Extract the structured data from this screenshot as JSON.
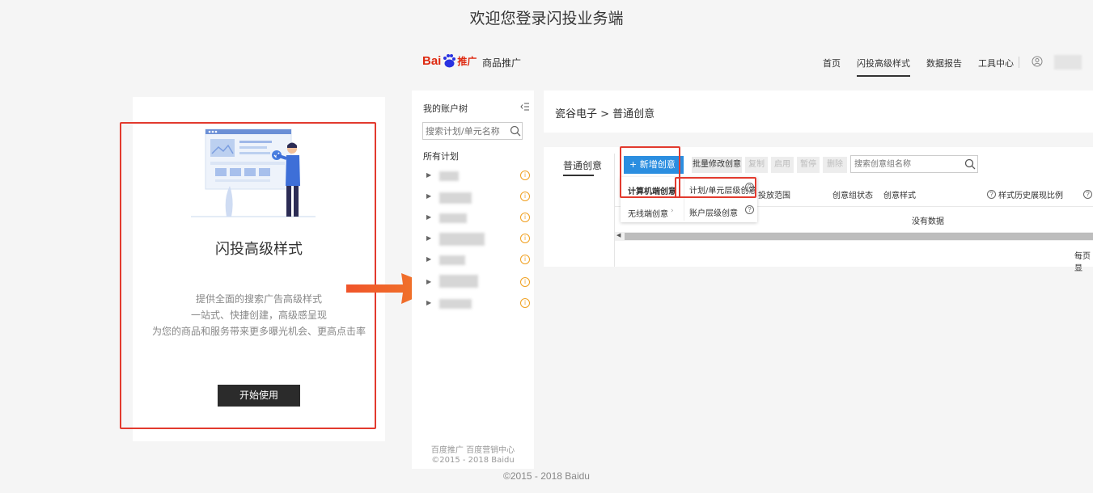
{
  "page": {
    "title": "欢迎您登录闪投业务端",
    "copyright": "©2015 - 2018 Baidu"
  },
  "intro": {
    "title": "闪投高级样式",
    "desc_lines": [
      "提供全面的搜索广告高级样式",
      "一站式、快捷创建，高级感呈现",
      "为您的商品和服务带来更多曝光机会、更高点击率"
    ],
    "start_button": "开始使用"
  },
  "header": {
    "logo_text": "Bai",
    "logo_suffix": "推广",
    "product": "商品推广",
    "nav": [
      "首页",
      "闪投高级样式",
      "数据报告",
      "工具中心"
    ],
    "active_nav": "闪投高级样式"
  },
  "tree": {
    "title": "我的账户树",
    "search_placeholder": "搜索计划/单元名称",
    "all_plans": "所有计划",
    "footer_links": "百度推广  百度营销中心",
    "footer_copyright": "©2015 - 2018 Baidu"
  },
  "breadcrumb": "瓷谷电子 > 普通创意",
  "content": {
    "tab": "普通创意",
    "new_button": "+ 新增创意",
    "toolbar": [
      "批量修改创意",
      "复制",
      "启用",
      "暂停",
      "删除"
    ],
    "search_placeholder": "搜索创意组名称",
    "columns": [
      "投放范围",
      "创意组状态",
      "创意样式",
      "样式历史展现比例"
    ],
    "empty_text": "没有数据",
    "per_page": "每页显"
  },
  "dropdown": {
    "left": [
      "计算机端创意",
      "无线端创意"
    ],
    "right": [
      "计划/单元层级创意",
      "账户层级创意"
    ]
  },
  "colors": {
    "accent": "#2b8ee0",
    "highlight": "#e23a2e",
    "arrow": "#f0542a",
    "baidu_red": "#de2910",
    "baidu_blue": "#2932e1",
    "warning": "#f0a020"
  }
}
